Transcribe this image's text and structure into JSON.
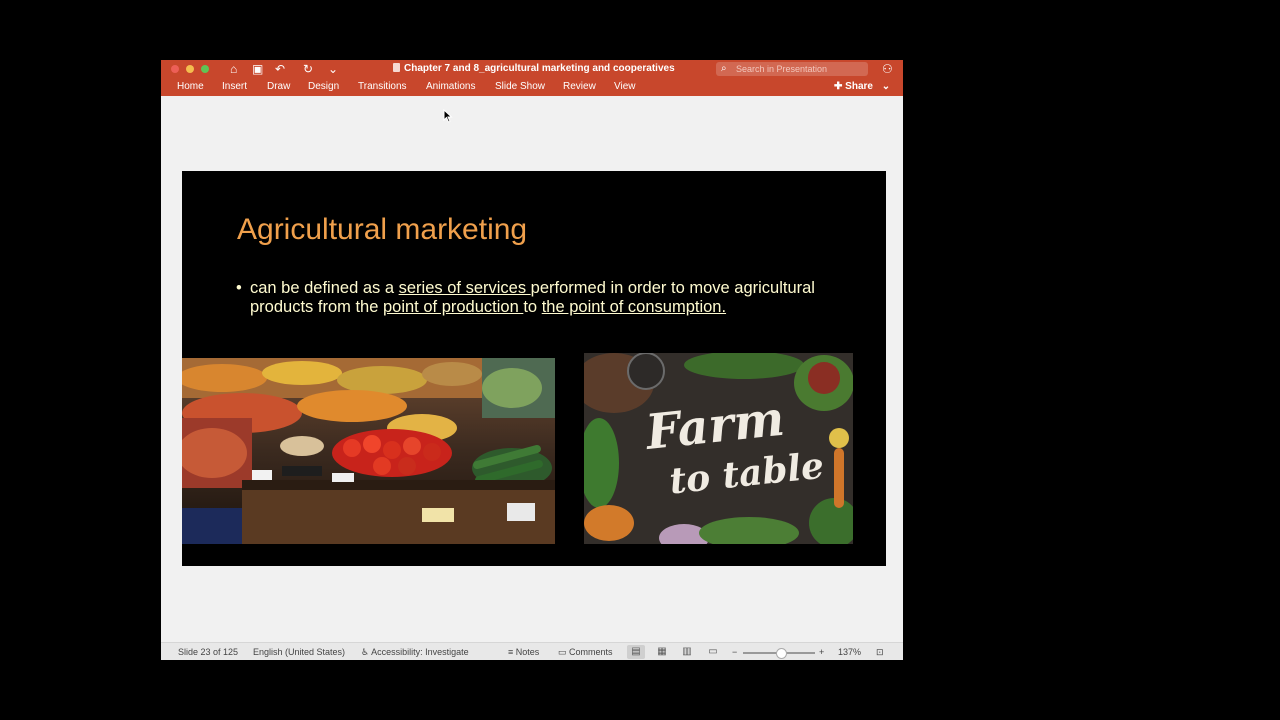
{
  "window": {
    "title": "Chapter 7 and 8_agricultural marketing and cooperatives",
    "search_placeholder": "Search in Presentation",
    "quick_access": [
      {
        "icon": "home-icon",
        "glyph": "⌂"
      },
      {
        "icon": "save-icon",
        "glyph": "▣"
      },
      {
        "icon": "undo-icon",
        "glyph": "↶"
      },
      {
        "icon": "redo-icon",
        "glyph": "↻"
      },
      {
        "icon": "customize-toolbar-icon",
        "glyph": "⌄"
      }
    ],
    "brand_color": "#c8472c"
  },
  "ribbon": {
    "tabs": [
      "Home",
      "Insert",
      "Draw",
      "Design",
      "Transitions",
      "Animations",
      "Slide Show",
      "Review",
      "View"
    ],
    "share_label": "Share"
  },
  "slide": {
    "title": "Agricultural marketing",
    "bullet": {
      "t1": "can be defined as a ",
      "u1": "series of services ",
      "t2": "performed in order to move agricultural products from the ",
      "u2": "point of production ",
      "t3": "to ",
      "u3": "the point of consumption."
    },
    "image2_text_line1": "Farm",
    "image2_text_line2": "to table",
    "title_color": "#f0a04c",
    "body_color": "#fffbd0"
  },
  "status": {
    "slide_indicator": "Slide 23 of 125",
    "language": "English (United States)",
    "accessibility": "Accessibility: Investigate",
    "notes": "Notes",
    "comments": "Comments",
    "zoom": "137%"
  }
}
